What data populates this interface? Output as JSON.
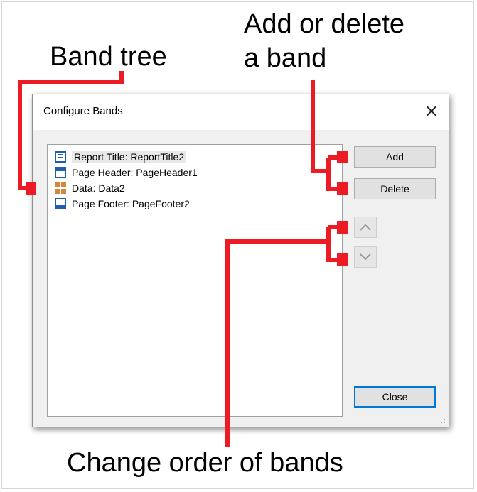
{
  "callouts": {
    "band_tree": "Band tree",
    "add_delete_line1": "Add or delete",
    "add_delete_line2": "a band",
    "change_order": "Change order of bands"
  },
  "dialog": {
    "title": "Configure Bands",
    "close_glyph": "×",
    "bands": [
      {
        "label": "Report Title: ReportTitle2",
        "icon": "report-title-icon"
      },
      {
        "label": "Page Header: PageHeader1",
        "icon": "page-header-icon"
      },
      {
        "label": "Data: Data2",
        "icon": "data-band-icon"
      },
      {
        "label": "Page Footer: PageFooter2",
        "icon": "page-footer-icon"
      }
    ],
    "buttons": {
      "add": "Add",
      "delete": "Delete",
      "close": "Close",
      "move_up": "⌃",
      "move_down": "⌄"
    }
  },
  "colors": {
    "annotation": "#ed1c24",
    "accent_border": "#0078d7",
    "band_icon_blue": "#1f5ea8",
    "data_icon_orange": "#d8863e"
  }
}
